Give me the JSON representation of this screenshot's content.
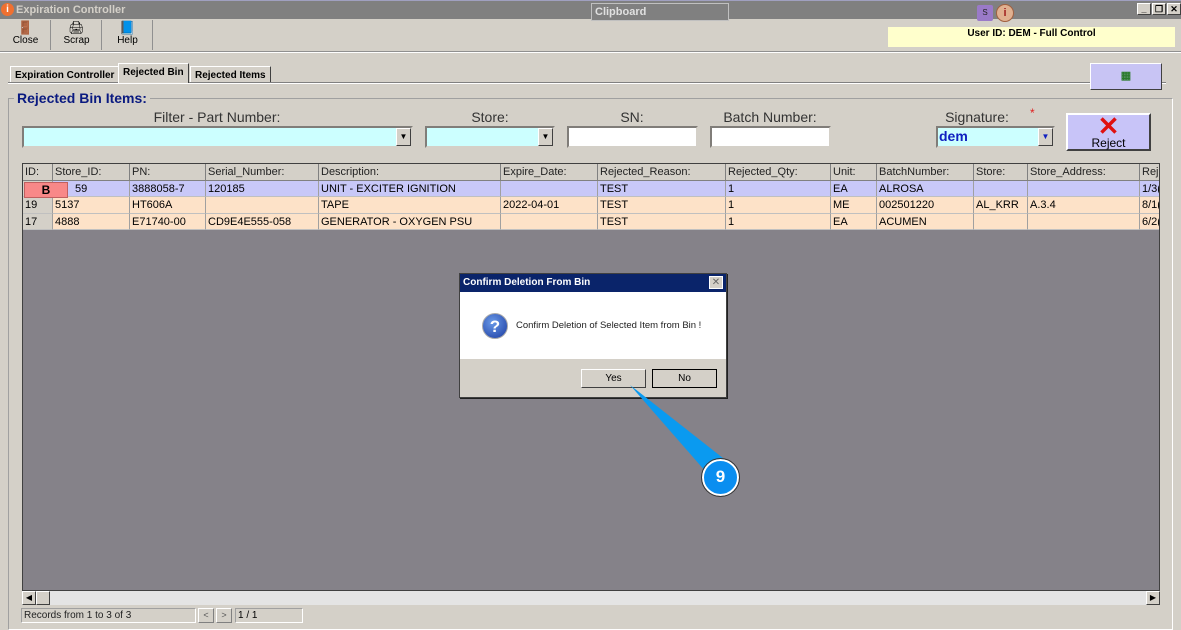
{
  "window": {
    "title": "Expiration Controller",
    "clipboard": "Clipboard",
    "app_icon": "i",
    "minimize": "_",
    "restore": "❐",
    "close": "✕"
  },
  "toolbar": {
    "close": "Close",
    "scrap": "Scrap",
    "help": "Help"
  },
  "user_bar": "User ID: DEM - Full Control",
  "tabs": [
    {
      "label": "Expiration Controller"
    },
    {
      "label": "Rejected Bin"
    },
    {
      "label": "Rejected Items"
    }
  ],
  "section_title": "Rejected Bin Items:",
  "filters": {
    "part_number_label": "Filter - Part Number:",
    "store_label": "Store:",
    "sn_label": "SN:",
    "batch_label": "Batch Number:",
    "signature_label": "Signature:",
    "required_mark": "*",
    "signature_value": "dem",
    "reject_label": "Reject"
  },
  "grid": {
    "columns": [
      "ID:",
      "Store_ID:",
      "PN:",
      "Serial_Number:",
      "Description:",
      "Expire_Date:",
      "Rejected_Reason:",
      "Rejected_Qty:",
      "Unit:",
      "BatchNumber:",
      "Store:",
      "Store_Address:",
      "Rej"
    ],
    "rows": [
      [
        "",
        "59",
        "3888058-7",
        "120185",
        "UNIT - EXCITER IGNITION",
        "",
        "TEST",
        "1",
        "EA",
        "ALROSA",
        "",
        "",
        "1/3("
      ],
      [
        "19",
        "5137",
        "HT606A",
        "",
        "TAPE",
        "2022-04-01",
        "TEST",
        "1",
        "ME",
        "002501220",
        "AL_KRR",
        "A.3.4",
        "8/1("
      ],
      [
        "17",
        "4888",
        "E71740-00",
        "CD9E4E555-058",
        "GENERATOR - OXYGEN PSU",
        "",
        "TEST",
        "1",
        "EA",
        "ACUMEN",
        "",
        "",
        "6/2("
      ]
    ],
    "row_badge": "B"
  },
  "status": {
    "records": "Records from 1 to 3 of 3",
    "prev": "<",
    "next": ">",
    "page": "1 / 1"
  },
  "dialog": {
    "title": "Confirm Deletion From Bin",
    "message": "Confirm Deletion of Selected Item from Bin !",
    "yes": "Yes",
    "no": "No"
  },
  "step_marker": "9",
  "colors": {
    "accent": "#0a8ef0",
    "selected_row": "#c8c8f8",
    "row": "#fde2c8",
    "title_bar": "#0a246a"
  }
}
